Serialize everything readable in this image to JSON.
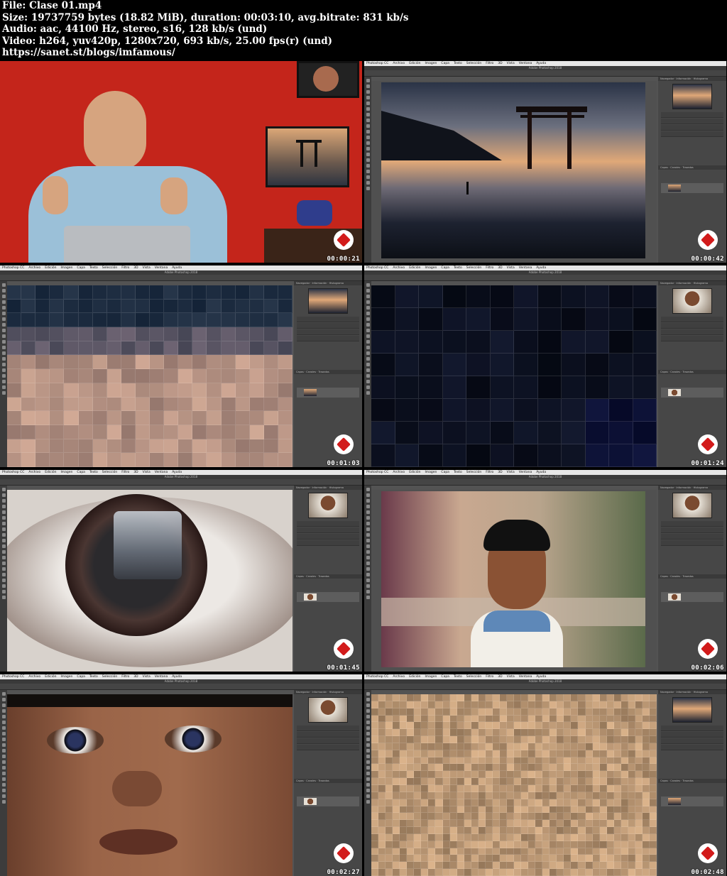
{
  "header": {
    "line1": "File: Clase 01.mp4",
    "line2": "Size: 19737759 bytes (18.82 MiB), duration: 00:03:10, avg.bitrate: 831 kb/s",
    "line3": "Audio: aac, 44100 Hz, stereo, s16, 128 kb/s (und)",
    "line4": "Video: h264, yuv420p, 1280x720, 693 kb/s, 25.00 fps(r) (und)",
    "line5": "https://sanet.st/blogs/imfamous/"
  },
  "app": {
    "title": "Adobe Photoshop 2018",
    "menu": [
      "Photoshop CC",
      "Archivo",
      "Edición",
      "Imagen",
      "Capa",
      "Texto",
      "Selección",
      "Filtro",
      "3D",
      "Vista",
      "Ventana",
      "Ayuda"
    ],
    "panel_tabs": [
      "Navegador",
      "Información",
      "Histograma"
    ],
    "layer_tabs": [
      "Capas",
      "Canales",
      "Trazados"
    ]
  },
  "thumbnails": [
    {
      "timestamp": "00:00:21",
      "scene": "presenter"
    },
    {
      "timestamp": "00:00:42",
      "scene": "torii"
    },
    {
      "timestamp": "00:01:03",
      "scene": "pixels-warm"
    },
    {
      "timestamp": "00:01:24",
      "scene": "pixels-dark"
    },
    {
      "timestamp": "00:01:45",
      "scene": "eye"
    },
    {
      "timestamp": "00:02:06",
      "scene": "boy"
    },
    {
      "timestamp": "00:02:27",
      "scene": "face"
    },
    {
      "timestamp": "00:02:48",
      "scene": "pixels-sand"
    }
  ],
  "colors": {
    "badge": "#d21b1b",
    "ps_bg": "#535353",
    "presenter_wall": "#c4251b"
  }
}
